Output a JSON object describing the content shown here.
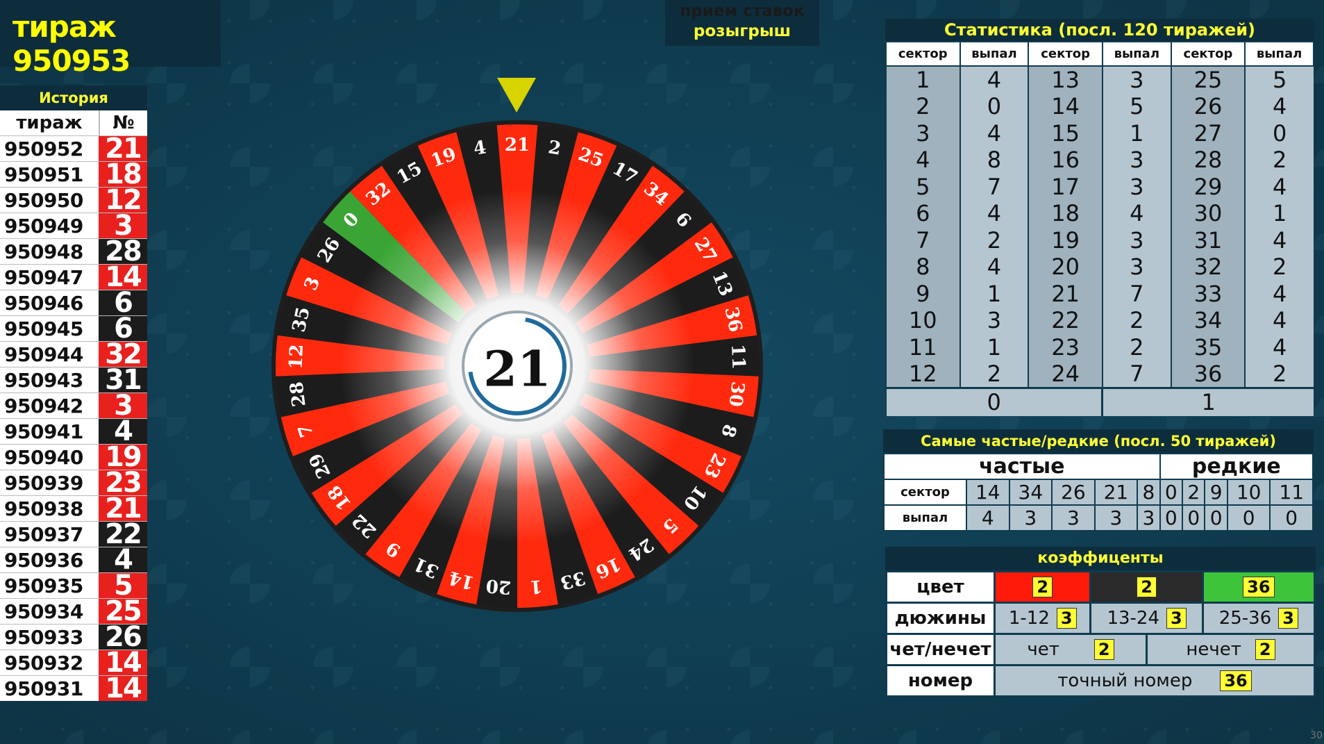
{
  "draw": {
    "label": "тираж 950953"
  },
  "phase": {
    "line1": "прием ставок",
    "line1_color": "#1a1a1a",
    "line2": "розыгрыш",
    "line2_color": "#ffff33"
  },
  "history": {
    "title": "История",
    "col_draw": "тираж",
    "col_num": "№",
    "rows": [
      {
        "draw": "950952",
        "num": "21",
        "color": "red"
      },
      {
        "draw": "950951",
        "num": "18",
        "color": "red"
      },
      {
        "draw": "950950",
        "num": "12",
        "color": "red"
      },
      {
        "draw": "950949",
        "num": "3",
        "color": "red"
      },
      {
        "draw": "950948",
        "num": "28",
        "color": "black"
      },
      {
        "draw": "950947",
        "num": "14",
        "color": "red"
      },
      {
        "draw": "950946",
        "num": "6",
        "color": "black"
      },
      {
        "draw": "950945",
        "num": "6",
        "color": "black"
      },
      {
        "draw": "950944",
        "num": "32",
        "color": "red"
      },
      {
        "draw": "950943",
        "num": "31",
        "color": "black"
      },
      {
        "draw": "950942",
        "num": "3",
        "color": "red"
      },
      {
        "draw": "950941",
        "num": "4",
        "color": "black"
      },
      {
        "draw": "950940",
        "num": "19",
        "color": "red"
      },
      {
        "draw": "950939",
        "num": "23",
        "color": "red"
      },
      {
        "draw": "950938",
        "num": "21",
        "color": "red"
      },
      {
        "draw": "950937",
        "num": "22",
        "color": "black"
      },
      {
        "draw": "950936",
        "num": "4",
        "color": "black"
      },
      {
        "draw": "950935",
        "num": "5",
        "color": "red"
      },
      {
        "draw": "950934",
        "num": "25",
        "color": "red"
      },
      {
        "draw": "950933",
        "num": "26",
        "color": "black"
      },
      {
        "draw": "950932",
        "num": "14",
        "color": "red"
      },
      {
        "draw": "950931",
        "num": "14",
        "color": "red"
      }
    ]
  },
  "wheel": {
    "result": "21",
    "pointer_at": "21",
    "sectors": [
      "21",
      "2",
      "25",
      "17",
      "34",
      "6",
      "27",
      "13",
      "36",
      "11",
      "30",
      "8",
      "23",
      "10",
      "5",
      "24",
      "16",
      "33",
      "1",
      "20",
      "14",
      "31",
      "9",
      "22",
      "18",
      "29",
      "7",
      "28",
      "12",
      "35",
      "3",
      "26",
      "0",
      "32",
      "15",
      "19",
      "4"
    ],
    "colors": {
      "red": "#ff2a0e",
      "black": "#1c1c1c",
      "green": "#3aa535"
    },
    "red_numbers": [
      "1",
      "3",
      "5",
      "7",
      "9",
      "12",
      "14",
      "16",
      "18",
      "19",
      "21",
      "23",
      "25",
      "27",
      "30",
      "32",
      "34",
      "36"
    ]
  },
  "stats": {
    "title": "Статистика (посл. 120 тиражей)",
    "headers": [
      "сектор",
      "выпал",
      "сектор",
      "выпал",
      "сектор",
      "выпал"
    ],
    "rows": [
      [
        "1",
        "4",
        "13",
        "3",
        "25",
        "5"
      ],
      [
        "2",
        "0",
        "14",
        "5",
        "26",
        "4"
      ],
      [
        "3",
        "4",
        "15",
        "1",
        "27",
        "0"
      ],
      [
        "4",
        "8",
        "16",
        "3",
        "28",
        "2"
      ],
      [
        "5",
        "7",
        "17",
        "3",
        "29",
        "4"
      ],
      [
        "6",
        "4",
        "18",
        "4",
        "30",
        "1"
      ],
      [
        "7",
        "2",
        "19",
        "3",
        "31",
        "4"
      ],
      [
        "8",
        "4",
        "20",
        "3",
        "32",
        "2"
      ],
      [
        "9",
        "1",
        "21",
        "7",
        "33",
        "4"
      ],
      [
        "10",
        "3",
        "22",
        "2",
        "34",
        "4"
      ],
      [
        "11",
        "1",
        "23",
        "2",
        "35",
        "4"
      ],
      [
        "12",
        "2",
        "24",
        "7",
        "36",
        "2"
      ]
    ],
    "zero_sector": "0",
    "zero_count": "1"
  },
  "frequent": {
    "title": "Самые частые/редкие (посл. 50 тиражей)",
    "freq_label": "частые",
    "rare_label": "редкие",
    "row_sector": "сектор",
    "row_count": "выпал",
    "freq_sectors": [
      "14",
      "34",
      "26",
      "21",
      "8"
    ],
    "freq_counts": [
      "4",
      "3",
      "3",
      "3",
      "3"
    ],
    "rare_sectors": [
      "0",
      "2",
      "9",
      "10",
      "11"
    ],
    "rare_counts": [
      "0",
      "0",
      "0",
      "0",
      "0"
    ]
  },
  "coef": {
    "title": "коэффиценты",
    "color_label": "цвет",
    "red": "2",
    "black": "2",
    "green": "36",
    "dozens_label": "дюжины",
    "d1": "1-12",
    "d1v": "3",
    "d2": "13-24",
    "d2v": "3",
    "d3": "25-36",
    "d3v": "3",
    "parity_label": "чет/нечет",
    "even": "чет",
    "even_v": "2",
    "odd": "нечет",
    "odd_v": "2",
    "number_label": "номер",
    "exact": "точный номер",
    "exact_v": "36"
  },
  "corner": "30"
}
